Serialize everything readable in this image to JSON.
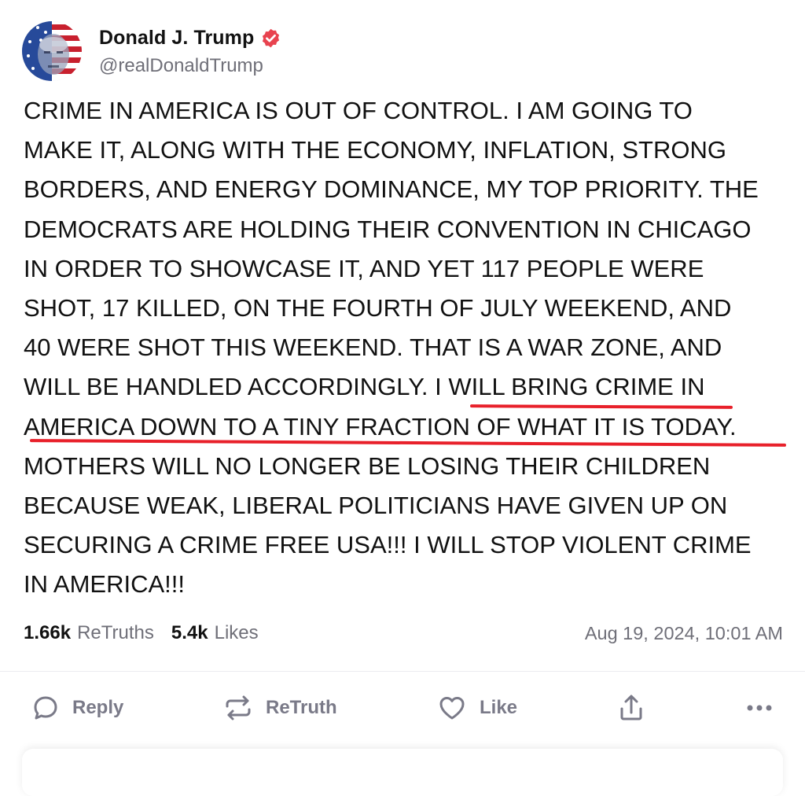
{
  "author": {
    "display_name": "Donald J. Trump",
    "handle": "@realDonaldTrump",
    "avatar_icon": "flag-portrait-avatar",
    "verified_icon": "verified-badge-icon",
    "verified_color": "#e8434f"
  },
  "post": {
    "lines": [
      "CRIME IN AMERICA IS OUT OF CONTROL. I AM GOING TO",
      "MAKE IT, ALONG WITH THE ECONOMY, INFLATION, STRONG",
      "BORDERS, AND ENERGY DOMINANCE, MY TOP PRIORITY. THE",
      "DEMOCRATS ARE HOLDING THEIR CONVENTION IN CHICAGO",
      "IN ORDER TO SHOWCASE IT, AND YET 117 PEOPLE WERE",
      "SHOT, 17 KILLED, ON THE FOURTH OF JULY WEEKEND, AND",
      "40 WERE SHOT THIS WEEKEND. THAT IS A WAR ZONE, AND",
      "WILL BE HANDLED ACCORDINGLY. I WILL BRING CRIME IN",
      "AMERICA DOWN TO A TINY FRACTION OF WHAT IT IS TODAY.",
      "MOTHERS WILL NO LONGER BE LOSING THEIR CHILDREN",
      "BECAUSE WEAK, LIBERAL POLITICIANS HAVE GIVEN UP ON",
      "SECURING A CRIME FREE USA!!! I WILL STOP VIOLENT CRIME",
      "IN AMERICA!!!"
    ],
    "highlight_color": "#e8202a"
  },
  "stats": {
    "retruths_count": "1.66k",
    "retruths_label": "ReTruths",
    "likes_count": "5.4k",
    "likes_label": "Likes",
    "timestamp": "Aug 19, 2024, 10:01 AM"
  },
  "actions": {
    "reply_label": "Reply",
    "retruth_label": "ReTruth",
    "like_label": "Like",
    "share_icon": "share-icon",
    "more_icon": "more-icon"
  }
}
